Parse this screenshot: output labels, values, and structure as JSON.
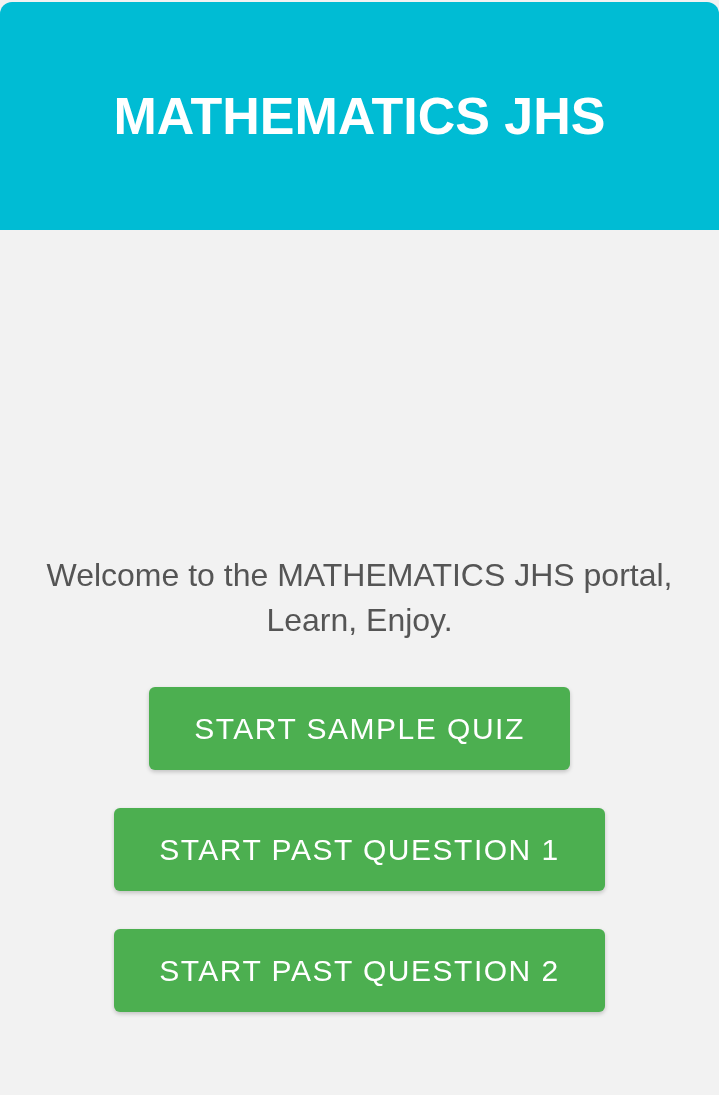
{
  "header": {
    "title": "MATHEMATICS JHS"
  },
  "welcome": "Welcome to the MATHEMATICS JHS portal, Learn, Enjoy.",
  "buttons": [
    "START SAMPLE QUIZ",
    "START PAST QUESTION 1",
    "START PAST QUESTION 2"
  ]
}
